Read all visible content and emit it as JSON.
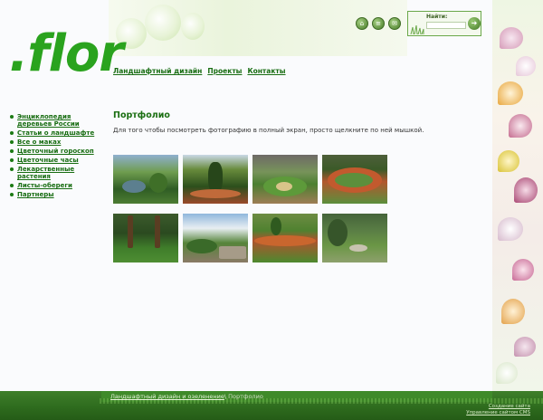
{
  "logo": {
    "text": ".flor"
  },
  "header": {
    "icons": [
      "home-icon",
      "sitemap-icon",
      "mail-icon"
    ],
    "search": {
      "label": "Найти:",
      "placeholder": "",
      "button_icon": "search-icon"
    }
  },
  "topnav": [
    {
      "label": "Ландшафтный дизайн"
    },
    {
      "label": "Проекты"
    },
    {
      "label": "Контакты"
    }
  ],
  "sidebar": {
    "items": [
      {
        "label": "Энциклопедия деревьев России"
      },
      {
        "label": "Статьи о ландшафте"
      },
      {
        "label": "Все о маках"
      },
      {
        "label": "Цветочный гороскоп"
      },
      {
        "label": "Цветочные часы"
      },
      {
        "label": "Лекарственные растения"
      },
      {
        "label": "Листы-обереги"
      },
      {
        "label": "Партнеры"
      }
    ]
  },
  "main": {
    "title": "Портфолио",
    "intro": "Для того чтобы посмотреть фотографию в полный экран, просто щелкните по ней мышкой.",
    "photos": [
      {
        "name": "portfolio-photo-1"
      },
      {
        "name": "portfolio-photo-2"
      },
      {
        "name": "portfolio-photo-3"
      },
      {
        "name": "portfolio-photo-4"
      },
      {
        "name": "portfolio-photo-5"
      },
      {
        "name": "portfolio-photo-6"
      },
      {
        "name": "portfolio-photo-7"
      },
      {
        "name": "portfolio-photo-8"
      }
    ]
  },
  "footer": {
    "breadcrumb_link": "Ландшафтный дизайн и озеленение",
    "breadcrumb_sep": "\\ ",
    "breadcrumb_current": "Портфолио",
    "links": [
      "Создание сайта",
      "Управление сайтом CMS"
    ]
  },
  "colors": {
    "accent": "#1b6f12",
    "logo": "#2aa31e",
    "footer": "#2d6a1d"
  }
}
